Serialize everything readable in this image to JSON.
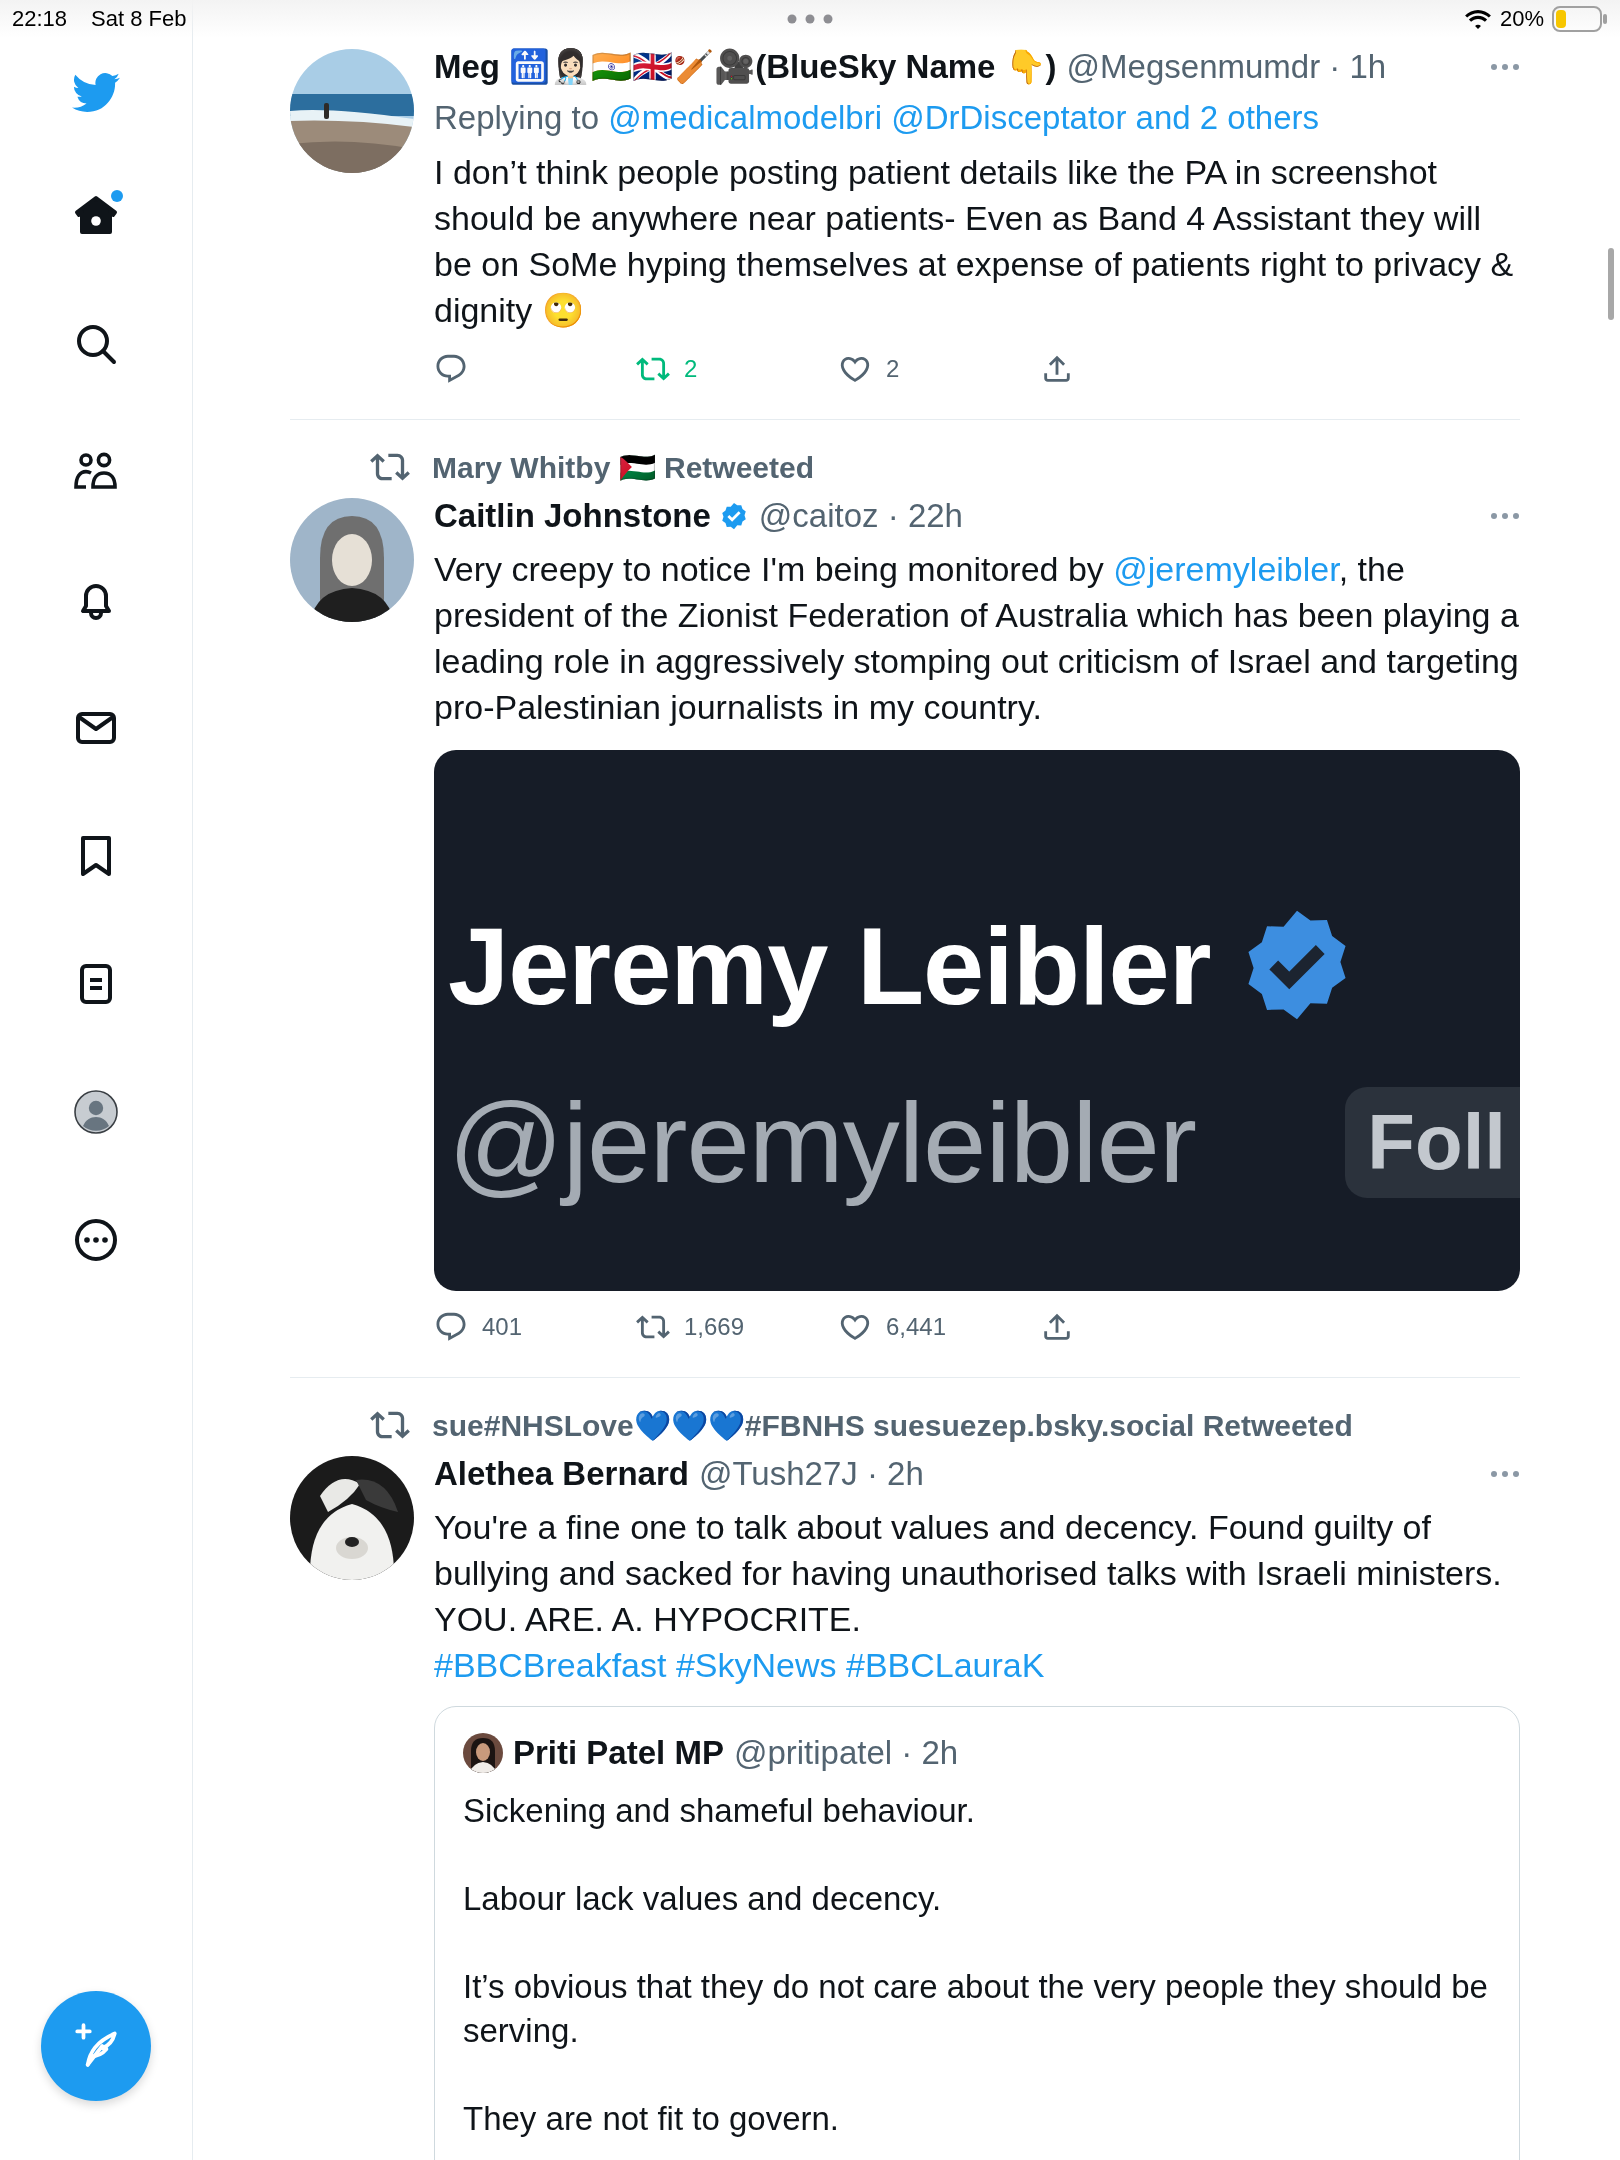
{
  "status_bar": {
    "time": "22:18",
    "date": "Sat 8 Feb",
    "battery": "20%"
  },
  "sidebar": {
    "items": [
      {
        "kind": "logo"
      },
      {
        "kind": "home",
        "selected": true,
        "unread": true
      },
      {
        "kind": "search",
        "selected": false
      },
      {
        "kind": "communities",
        "selected": false
      },
      {
        "kind": "notifications",
        "selected": false
      },
      {
        "kind": "messages",
        "selected": false
      },
      {
        "kind": "bookmarks",
        "selected": false
      },
      {
        "kind": "lists",
        "selected": false
      },
      {
        "kind": "profile"
      },
      {
        "kind": "more"
      }
    ]
  },
  "tweets": [
    {
      "avatar": {
        "kind": "picture"
      },
      "name": "Meg 🛗👩🏻‍⚕️🇮🇳🇬🇧🏏🎥(BlueSky Name 👇)",
      "meta": "@Megsenmumdr · 1h",
      "replying_to": {
        "label": "Replying to",
        "link": "@medicalmodelbri @DrDisceptator and 2 others"
      },
      "paragraphs": [
        [
          {
            "kind": "text",
            "text": "I don’t think people posting patient details like the PA in screenshot should be anywhere near patients- Even as Band 4 Assistant they will be on SoMe hyping themselves at expense of patients right to privacy & dignity 🙄"
          }
        ]
      ],
      "actions": [
        {
          "kind": "reply",
          "active": false
        },
        {
          "kind": "retweet",
          "count": "2",
          "active": true
        },
        {
          "kind": "like",
          "count": "2",
          "active": false
        },
        {
          "kind": "share",
          "active": false
        }
      ]
    },
    {
      "social_context": "Mary Whitby 🇵🇸 Retweeted",
      "avatar": {
        "kind": "picture"
      },
      "name": "Caitlin Johnstone",
      "verified": true,
      "meta": "@caitoz · 22h",
      "paragraphs": [
        [
          {
            "kind": "text",
            "text": "Very creepy to notice I'm being monitored by "
          },
          {
            "kind": "mention",
            "text": "@jeremyleibler"
          },
          {
            "kind": "text",
            "text": ", the president of the Zionist Federation of Australia which has been playing a leading role in aggressively stomping out criticism of Israel and targeting pro-Palestinian journalists in my country."
          }
        ]
      ],
      "media": {
        "kind": "screenshot",
        "title": "Jeremy Leibler",
        "verified": true,
        "handle": "@jeremyleibler",
        "button": "Foll"
      },
      "actions": [
        {
          "kind": "reply",
          "count": "401",
          "active": false
        },
        {
          "kind": "retweet",
          "count": "1,669",
          "active": false
        },
        {
          "kind": "like",
          "count": "6,441",
          "active": false
        },
        {
          "kind": "share",
          "active": false
        }
      ]
    },
    {
      "social_context": "sue#NHSLove💙💙💙#FBNHS suesuezep.bsky.social Retweeted",
      "avatar": {
        "kind": "picture"
      },
      "name": "Alethea Bernard",
      "meta": "@Tush27J · 2h",
      "paragraphs": [
        [
          {
            "kind": "text",
            "text": "You're a fine one to talk about values and decency. Found guilty of bullying and sacked for having unauthorised talks with Israeli ministers. YOU. ARE. A. HYPOCRITE."
          }
        ],
        [
          {
            "kind": "hashtag",
            "text": "#BBCBreakfast"
          },
          {
            "kind": "hashtag",
            "text": "#SkyNews"
          },
          {
            "kind": "hashtag",
            "text": "#BBCLauraK"
          }
        ]
      ],
      "quote": {
        "avatar": {
          "kind": "picture"
        },
        "name": "Priti Patel MP",
        "meta": "@pritipatel · 2h",
        "paragraphs": [
          "Sickening and shameful behaviour.",
          "Labour lack values and decency.",
          "It’s obvious that they do not care about the very people they should be serving.",
          "They are not fit to govern."
        ]
      }
    }
  ]
}
